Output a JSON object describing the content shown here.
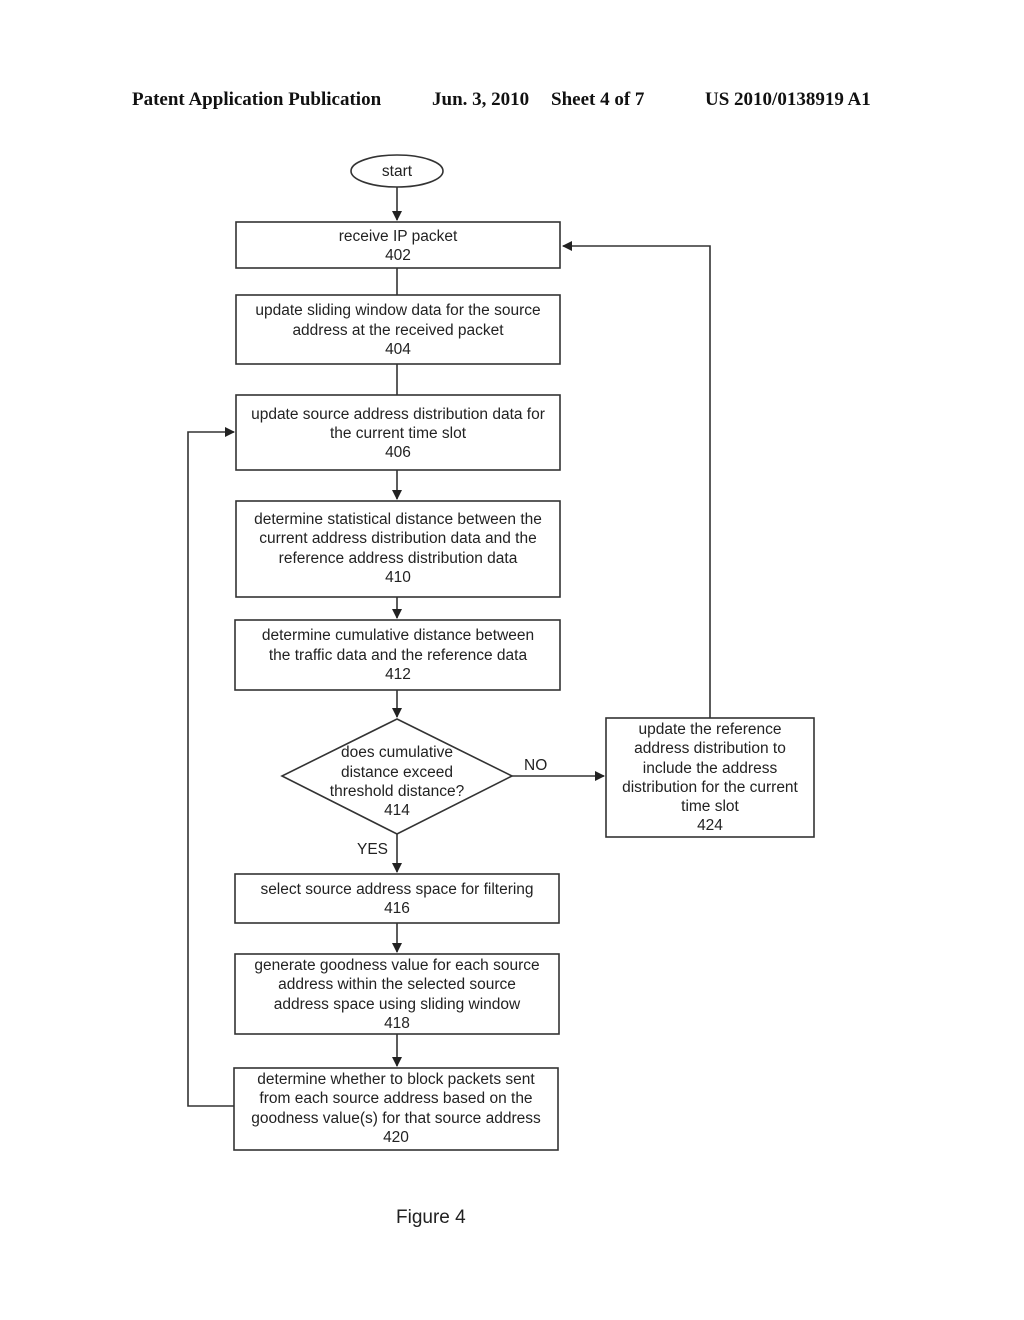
{
  "header": {
    "publication_type": "Patent Application Publication",
    "date": "Jun. 3, 2010",
    "sheet": "Sheet 4 of 7",
    "patent_number": "US 2010/0138919 A1"
  },
  "figure": {
    "caption": "Figure 4",
    "start_label": "start",
    "nodes": [
      {
        "id": "402",
        "type": "process",
        "lines": [
          "receive IP packet"
        ],
        "ref": "402"
      },
      {
        "id": "404",
        "type": "process",
        "lines": [
          "update sliding window data for the source",
          "address at the received packet"
        ],
        "ref": "404"
      },
      {
        "id": "406",
        "type": "process",
        "lines": [
          "update source address distribution data for",
          "the current time slot"
        ],
        "ref": "406"
      },
      {
        "id": "410",
        "type": "process",
        "lines": [
          "determine statistical distance between the",
          "current address distribution data and the",
          "reference address distribution data"
        ],
        "ref": "410"
      },
      {
        "id": "412",
        "type": "process",
        "lines": [
          "determine cumulative distance between",
          "the traffic data and the reference data"
        ],
        "ref": "412"
      },
      {
        "id": "414",
        "type": "decision",
        "lines": [
          "does cumulative",
          "distance exceed",
          "threshold distance?"
        ],
        "ref": "414"
      },
      {
        "id": "424",
        "type": "process",
        "lines": [
          "update the reference",
          "address distribution to",
          "include the address",
          "distribution for the current",
          "time slot"
        ],
        "ref": "424"
      },
      {
        "id": "416",
        "type": "process",
        "lines": [
          "select source address space for filtering"
        ],
        "ref": "416"
      },
      {
        "id": "418",
        "type": "process",
        "lines": [
          "generate goodness value for each source",
          "address within the selected source",
          "address space using sliding window"
        ],
        "ref": "418"
      },
      {
        "id": "420",
        "type": "process",
        "lines": [
          "determine whether to block packets sent",
          "from each source address based on the",
          "goodness value(s) for that source address"
        ],
        "ref": "420"
      }
    ],
    "edges": [
      {
        "from": "start",
        "to": "402"
      },
      {
        "from": "402",
        "to": "404"
      },
      {
        "from": "404",
        "to": "406"
      },
      {
        "from": "406",
        "to": "410"
      },
      {
        "from": "410",
        "to": "412"
      },
      {
        "from": "412",
        "to": "414"
      },
      {
        "from": "414",
        "to": "424",
        "label": "NO"
      },
      {
        "from": "414",
        "to": "416",
        "label": "YES"
      },
      {
        "from": "424",
        "to": "402"
      },
      {
        "from": "416",
        "to": "418"
      },
      {
        "from": "418",
        "to": "420"
      },
      {
        "from": "420",
        "to": "406"
      }
    ]
  }
}
